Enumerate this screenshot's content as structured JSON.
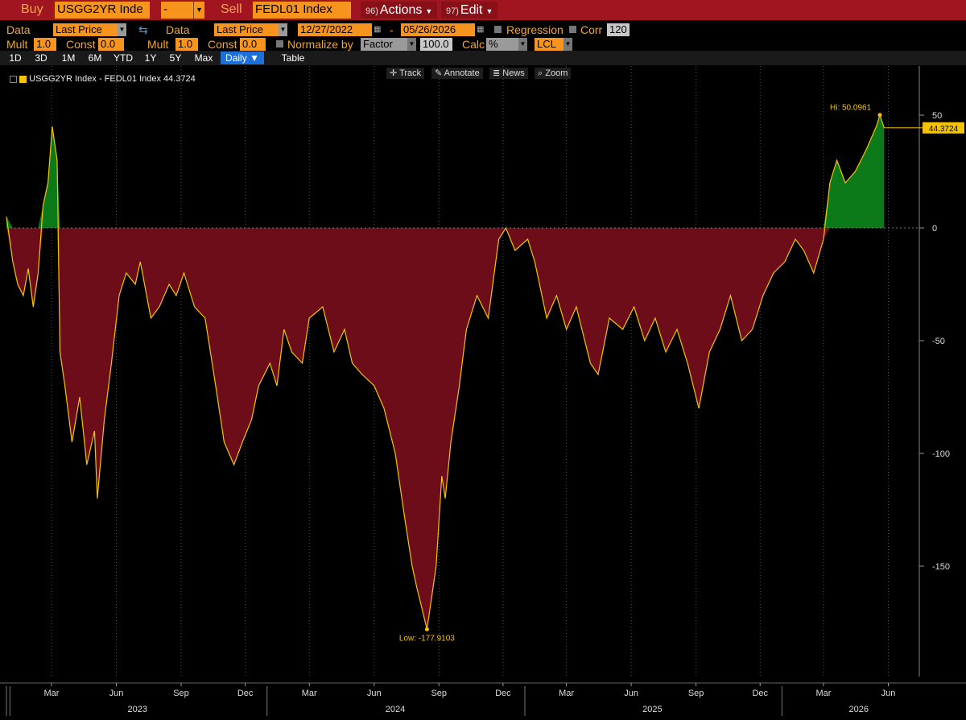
{
  "topbar": {
    "buy_label": "Buy",
    "buy_security": "USGG2YR Inde",
    "buy_side": "-",
    "sell_label": "Sell",
    "sell_security": "FEDL01 Index",
    "actions_num": "96)",
    "actions_label": "Actions",
    "edit_num": "97)",
    "edit_label": "Edit"
  },
  "row2": {
    "data1_label": "Data",
    "data1_value": "Last Price",
    "swap_icon": "swap-arrows-icon",
    "data2_label": "Data",
    "data2_value": "Last Price",
    "start_date": "12/27/2022",
    "date_sep": "-",
    "end_date": "05/26/2026",
    "regression_label": "Regression",
    "corr_label": "Corr",
    "corr_value": "120"
  },
  "row3": {
    "mult1_label": "Mult",
    "mult1_value": "1.0",
    "const1_label": "Const",
    "const1_value": "0.0",
    "mult2_label": "Mult",
    "mult2_value": "1.0",
    "const2_label": "Const",
    "const2_value": "0.0",
    "normalize_label": "Normalize by",
    "normalize_value": "Factor",
    "normalize_num": "100.0",
    "calc_label": "Calc",
    "calc_value": "%",
    "currency_value": "LCL"
  },
  "range_tabs": [
    "1D",
    "3D",
    "1M",
    "6M",
    "YTD",
    "1Y",
    "5Y",
    "Max"
  ],
  "freq": "Daily",
  "table_label": "Table",
  "tools": {
    "track": "Track",
    "annotate": "Annotate",
    "news": "News",
    "zoom": "Zoom"
  },
  "legend": {
    "text": "USGG2YR Index - FEDL01 Index 44.3724"
  },
  "colors": {
    "positive_fill": "#0d7a1a",
    "negative_fill": "#6e0d1a",
    "line": "#f5c400",
    "accent": "#f7941d",
    "bar": "#a01520"
  },
  "chart_data": {
    "type": "area",
    "series": [
      {
        "name": "USGG2YR Index - FEDL01 Index",
        "x": [
          "2022-12-27",
          "2023-01-05",
          "2023-01-12",
          "2023-01-20",
          "2023-01-27",
          "2023-02-03",
          "2023-02-10",
          "2023-02-17",
          "2023-02-24",
          "2023-03-02",
          "2023-03-09",
          "2023-03-13",
          "2023-03-20",
          "2023-03-30",
          "2023-04-10",
          "2023-04-20",
          "2023-05-01",
          "2023-05-05",
          "2023-05-15",
          "2023-05-25",
          "2023-06-05",
          "2023-06-15",
          "2023-06-28",
          "2023-07-05",
          "2023-07-20",
          "2023-08-01",
          "2023-08-15",
          "2023-08-25",
          "2023-09-05",
          "2023-09-20",
          "2023-10-05",
          "2023-10-20",
          "2023-11-01",
          "2023-11-15",
          "2023-11-27",
          "2023-12-10",
          "2023-12-20",
          "2024-01-05",
          "2024-01-15",
          "2024-01-25",
          "2024-02-05",
          "2024-02-20",
          "2024-03-01",
          "2024-03-20",
          "2024-04-05",
          "2024-04-20",
          "2024-05-01",
          "2024-05-15",
          "2024-06-01",
          "2024-06-15",
          "2024-07-01",
          "2024-07-15",
          "2024-07-25",
          "2024-08-01",
          "2024-08-05",
          "2024-08-15",
          "2024-08-28",
          "2024-09-05",
          "2024-09-10",
          "2024-09-18",
          "2024-09-30",
          "2024-10-10",
          "2024-10-25",
          "2024-11-10",
          "2024-11-25",
          "2024-12-05",
          "2024-12-18",
          "2025-01-05",
          "2025-01-15",
          "2025-02-01",
          "2025-02-15",
          "2025-03-01",
          "2025-03-15",
          "2025-04-04",
          "2025-04-15",
          "2025-05-01",
          "2025-05-20",
          "2025-06-05",
          "2025-06-20",
          "2025-07-05",
          "2025-07-20",
          "2025-08-05",
          "2025-08-20",
          "2025-09-05",
          "2025-09-20",
          "2025-10-05",
          "2025-10-20",
          "2025-11-05",
          "2025-11-20",
          "2025-12-05",
          "2025-12-20",
          "2026-01-05",
          "2026-01-20",
          "2026-02-01",
          "2026-02-15",
          "2026-03-01",
          "2026-03-10",
          "2026-03-20",
          "2026-04-01",
          "2026-04-15",
          "2026-05-01",
          "2026-05-15",
          "2026-05-20",
          "2026-05-26"
        ],
        "y": [
          5,
          -15,
          -25,
          -30,
          -18,
          -35,
          -20,
          10,
          20,
          45,
          30,
          -55,
          -70,
          -95,
          -75,
          -105,
          -90,
          -120,
          -85,
          -60,
          -30,
          -20,
          -25,
          -15,
          -40,
          -35,
          -25,
          -30,
          -20,
          -35,
          -40,
          -70,
          -95,
          -105,
          -95,
          -85,
          -70,
          -60,
          -70,
          -45,
          -55,
          -60,
          -40,
          -35,
          -55,
          -45,
          -60,
          -65,
          -70,
          -80,
          -100,
          -130,
          -150,
          -160,
          -165,
          -178,
          -150,
          -110,
          -120,
          -95,
          -70,
          -45,
          -30,
          -40,
          -5,
          0,
          -10,
          -5,
          -15,
          -40,
          -30,
          -45,
          -35,
          -60,
          -65,
          -40,
          -45,
          -35,
          -50,
          -40,
          -55,
          -45,
          -60,
          -80,
          -55,
          -45,
          -30,
          -50,
          -45,
          -30,
          -20,
          -15,
          -5,
          -10,
          -20,
          -5,
          20,
          30,
          20,
          25,
          35,
          45,
          50.0961,
          44.3724
        ]
      }
    ],
    "xtick_months": [
      "Mar",
      "Jun",
      "Sep",
      "Dec",
      "Mar",
      "Jun",
      "Sep",
      "Dec",
      "Mar",
      "Jun",
      "Sep",
      "Dec",
      "Mar",
      "Jun"
    ],
    "xtick_years": [
      "2023",
      "2024",
      "2025",
      "2026"
    ],
    "yticks": [
      50,
      0,
      -50,
      -100,
      -150
    ],
    "ylim": [
      -200,
      50
    ],
    "hi_label": "Hi: 50.0961",
    "low_label": "Low: -177.9103",
    "last_value": "44.3724",
    "grid": "vertical dotted",
    "legend_position": "top-left"
  }
}
